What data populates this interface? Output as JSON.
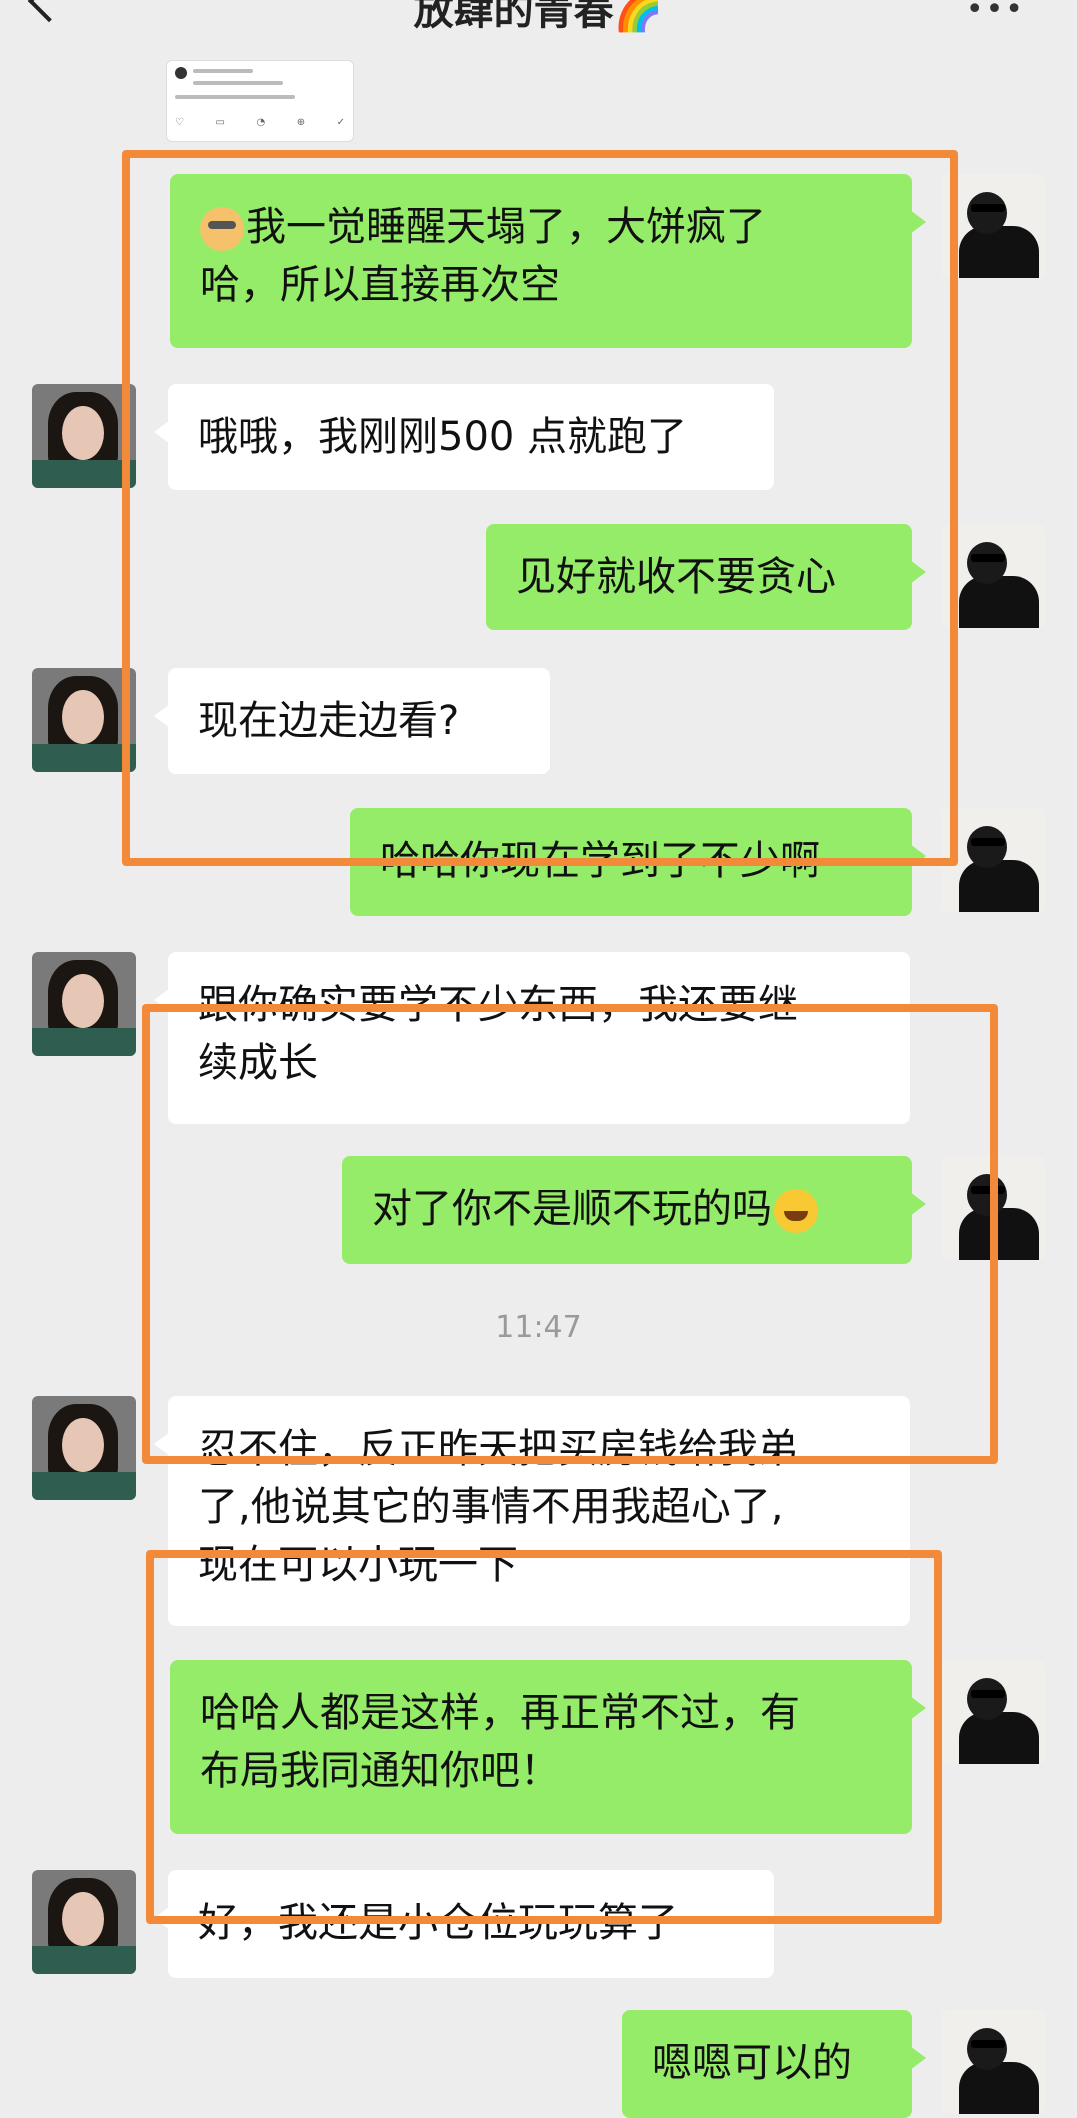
{
  "header": {
    "title": "放肆的青春🌈",
    "more_icon": "more-icon",
    "back_icon": "back-arrow-icon"
  },
  "thumbnail": {
    "icons": [
      "like-icon",
      "comment-icon",
      "notify-icon",
      "forward-icon",
      "follow-icon"
    ]
  },
  "messages": [
    {
      "side": "right",
      "text": "我一觉睡醒天塌了，大饼疯了\n哈，所以直接再次空",
      "emoji": "dog-sunglasses"
    },
    {
      "side": "left",
      "text": "哦哦，我刚刚500 点就跑了"
    },
    {
      "side": "right",
      "text": "见好就收不要贪心"
    },
    {
      "side": "left",
      "text": "现在边走边看?"
    },
    {
      "side": "right",
      "text": "哈哈你现在学到了不少啊"
    },
    {
      "side": "left",
      "text": "跟你确实要学不少东西，我还要继\n续成长"
    },
    {
      "side": "right",
      "text": "对了你不是顺不玩的吗",
      "emoji": "laugh-cry"
    },
    {
      "side": "left",
      "text": "忍不住，反正昨天把买房钱给我弟\n了,他说其它的事情不用我超心了,\n现在可以小玩一下"
    },
    {
      "side": "right",
      "text": "哈哈人都是这样，再正常不过，有\n布局我同通知你吧！"
    },
    {
      "side": "left",
      "text": "好，我还是小仓位玩玩算了"
    },
    {
      "side": "right",
      "text": "嗯嗯可以的"
    }
  ],
  "timestamp": "11:47",
  "colors": {
    "background": "#ededed",
    "green_bubble": "#95ec69",
    "white_bubble": "#ffffff",
    "highlight_box": "#f28a3a"
  }
}
